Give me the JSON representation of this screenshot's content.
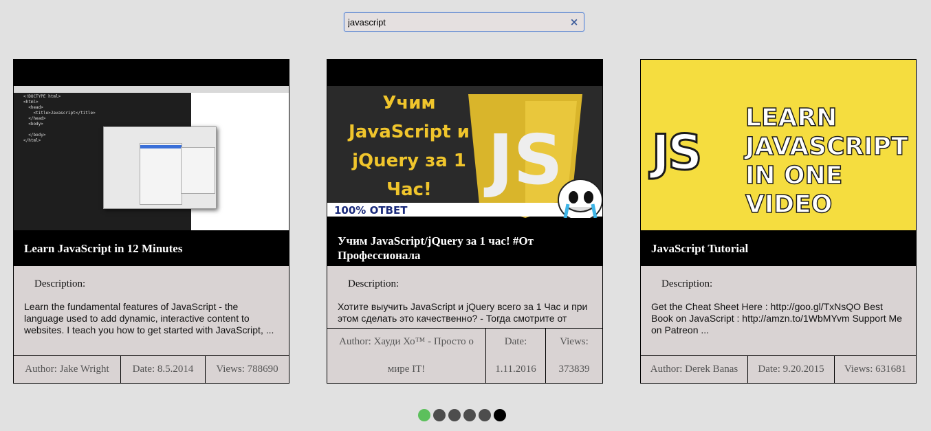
{
  "search": {
    "value": "javascript",
    "clear_icon": "×"
  },
  "cards": [
    {
      "title": "Learn JavaScript in 12 Minutes",
      "description_label": "Description:",
      "description": "Learn the fundamental features of JavaScript - the language used to add dynamic, interactive content to websites. I teach you how to get started with JavaScript, ...",
      "author": "Author: Jake Wright",
      "date": "Date: 8.5.2014",
      "views": "Views: 788690"
    },
    {
      "title": "Учим JavaScript/jQuery за 1 час! #От Профессионала",
      "description_label": "Description:",
      "description": "Хотите выучить JavaScript и jQuery всего за 1 Час и при этом сделать это качественно? - Тогда смотрите от",
      "author_line1": "Author: Хауди Хо™ - Просто о",
      "author_line2": "мире IT!",
      "date_label": "Date:",
      "date_value": "1.11.2016",
      "views_label": "Views:",
      "views_value": "373839",
      "thumb_text": "Учим JavaScript и jQuery за 1 Час!",
      "thumb_banner": "100% ОТВЕТ",
      "thumb_logo": "JS"
    },
    {
      "title": "JavaScript Tutorial",
      "description_label": "Description:",
      "description": "Get the Cheat Sheet Here : http://goo.gl/TxNsQO Best Book on JavaScript : http://amzn.to/1WbMYvm Support Me on Patreon ...",
      "author": "Author: Derek Banas",
      "date": "Date: 9.20.2015",
      "views": "Views: 631681",
      "thumb_logo": "JS",
      "thumb_text": "LEARN JAVASCRIPT IN ONE VIDEO"
    }
  ],
  "pagination": {
    "count": 6,
    "active_index": 0,
    "last_index_dark": 5,
    "colors": {
      "active": "#5cc05c",
      "inactive": "#4d4d4d",
      "last": "#000000"
    }
  },
  "thumb1_code": "<!DOCTYPE html>\n<html>\n  <head>\n    <title>Javascript</title>\n  </head>\n  <body>\n\n  </body>\n</html>"
}
